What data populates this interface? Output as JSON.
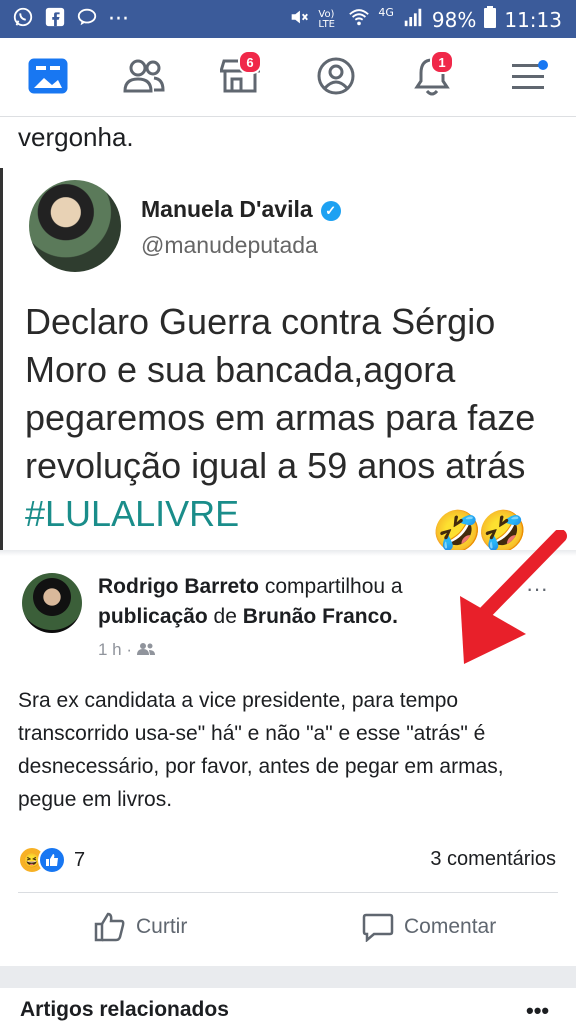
{
  "status_bar": {
    "battery": "98%",
    "time": "11:13",
    "network": "4G",
    "volte": "Vo) LTE"
  },
  "nav": {
    "marketplace_badge": "6",
    "notifications_badge": "1"
  },
  "top_text": "vergonha.",
  "embed": {
    "name": "Manuela D'avila",
    "verified_mark": "✓",
    "handle": "@manudeputada",
    "lines": [
      "Declaro Guerra contra Sérgio",
      "Moro e sua bancada,agora",
      "pegaremos em armas para faze",
      "revolução igual a 59 anos atrás"
    ],
    "hashtag": "#LULALIVRE",
    "emojis": "🤣🤣"
  },
  "post": {
    "author": "Rodrigo Barreto",
    "action": "compartilhou a",
    "object_prefix": "publicação",
    "object_connector": "de",
    "object_author": "Brunão Franco.",
    "more": "···",
    "time": "1 h ·",
    "body": "Sra ex candidata a vice presidente, para tempo transcorrido usa-se\" há\" e não \"a\" e esse \"atrás\" é desnecessário, por favor, antes de pegar em armas, pegue em livros.",
    "reaction_count": "7",
    "comments": "3 comentários",
    "like_label": "Curtir",
    "comment_label": "Comentar"
  },
  "related": {
    "title": "Artigos relacionados",
    "more": "•••"
  },
  "colors": {
    "status_bar": "#3b5b9a",
    "facebook_blue": "#1877f2",
    "badge_red": "#f02849",
    "hashtag": "#1a8d8a",
    "arrow": "#e8202a"
  }
}
